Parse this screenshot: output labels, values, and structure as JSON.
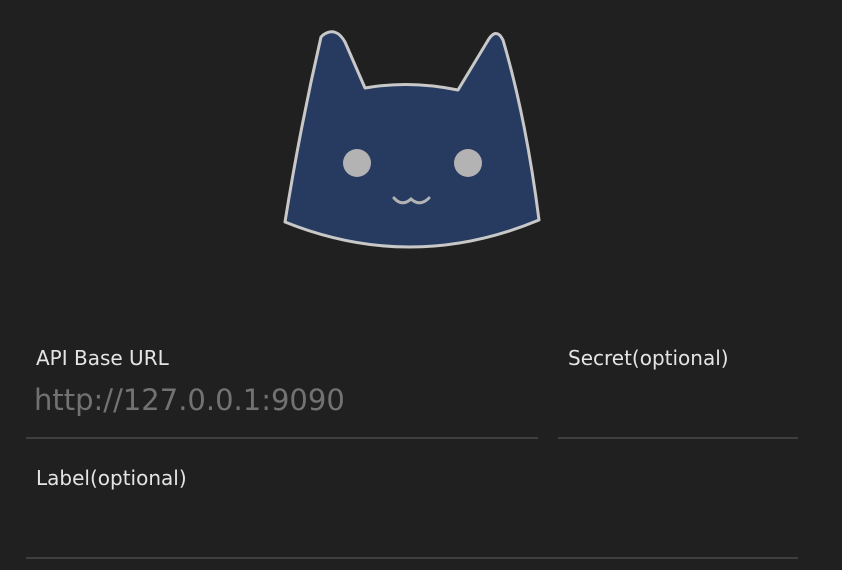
{
  "logo": {
    "icon": "cat-logo-icon",
    "fill_color": "#273a60",
    "stroke_color": "#c8c8c8"
  },
  "form": {
    "api_base_url": {
      "label": "API Base URL",
      "value": "",
      "placeholder": "http://127.0.0.1:9090"
    },
    "secret": {
      "label": "Secret(optional)",
      "value": "",
      "placeholder": ""
    },
    "label": {
      "label": "Label(optional)",
      "value": "",
      "placeholder": ""
    }
  },
  "colors": {
    "background": "#202020",
    "text": "#e4e4e4",
    "placeholder": "#727272",
    "underline": "#3f3f3f"
  }
}
